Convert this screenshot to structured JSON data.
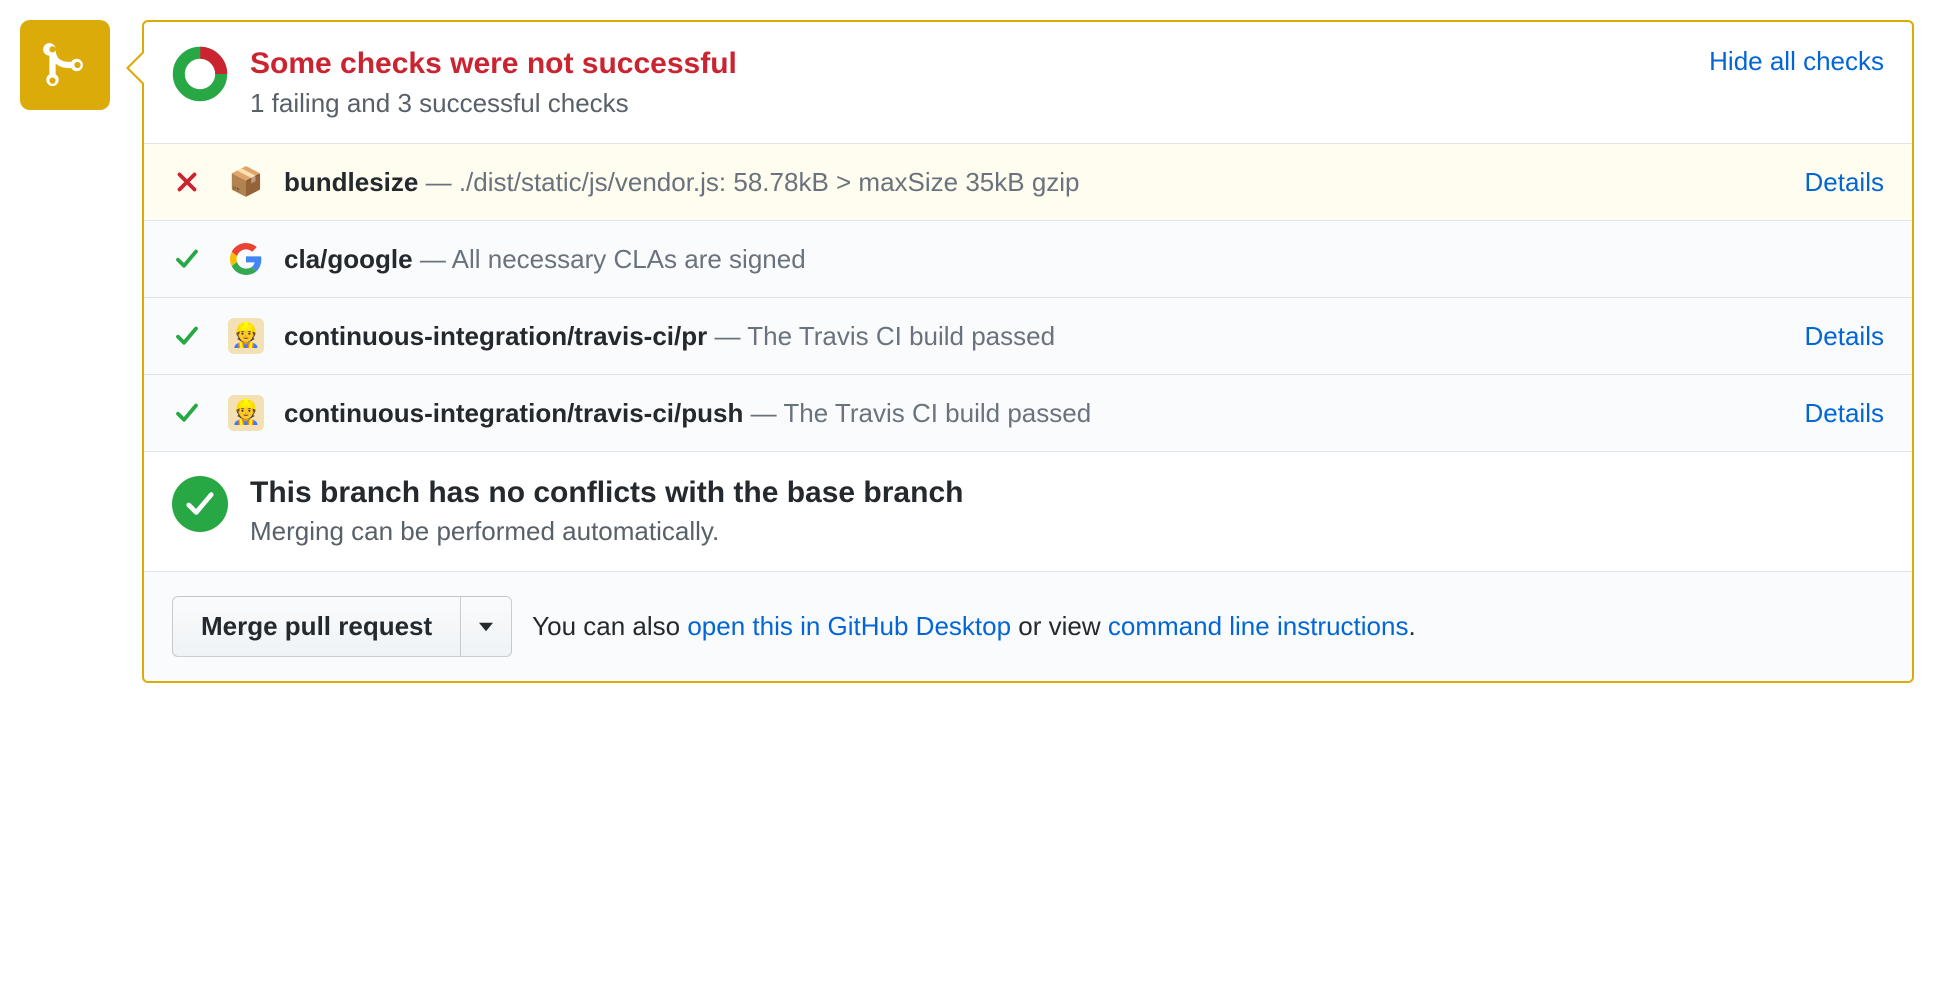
{
  "summary": {
    "title": "Some checks were not successful",
    "subtitle": "1 failing and 3 successful checks",
    "toggle_label": "Hide all checks"
  },
  "checks": [
    {
      "status": "fail",
      "avatar": "package",
      "name": "bundlesize",
      "desc": "./dist/static/js/vendor.js: 58.78kB > maxSize 35kB gzip",
      "details": "Details"
    },
    {
      "status": "pass",
      "avatar": "google",
      "name": "cla/google",
      "desc": "All necessary CLAs are signed",
      "details": ""
    },
    {
      "status": "pass",
      "avatar": "travis",
      "name": "continuous-integration/travis-ci/pr",
      "desc": "The Travis CI build passed",
      "details": "Details"
    },
    {
      "status": "pass",
      "avatar": "travis",
      "name": "continuous-integration/travis-ci/push",
      "desc": "The Travis CI build passed",
      "details": "Details"
    }
  ],
  "merge": {
    "title": "This branch has no conflicts with the base branch",
    "subtitle": "Merging can be performed automatically."
  },
  "actions": {
    "merge_button": "Merge pull request",
    "hint_prefix": "You can also ",
    "desktop_link": "open this in GitHub Desktop",
    "hint_middle": " or view ",
    "cli_link": "command line instructions",
    "hint_suffix": "."
  }
}
